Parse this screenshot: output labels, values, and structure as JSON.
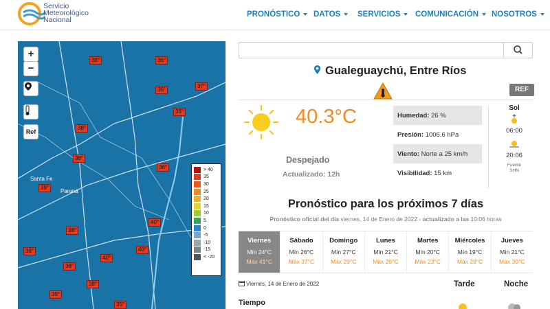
{
  "brand": {
    "line1": "Servicio",
    "line2": "Meteorológico",
    "line3": "Nacional"
  },
  "nav": [
    {
      "label": "PRONÓSTICO"
    },
    {
      "label": "DATOS"
    },
    {
      "label": "SERVICIOS"
    },
    {
      "label": "COMUNICACIÓN"
    },
    {
      "label": "NOSOTROS"
    }
  ],
  "map": {
    "zoom_in": "+",
    "zoom_out": "−",
    "ref_label": "Ref",
    "cities": [
      "Santa Fe",
      "Paraná"
    ],
    "temps": [
      {
        "v": "38°"
      },
      {
        "v": "36°"
      },
      {
        "v": "36°"
      },
      {
        "v": "37°"
      },
      {
        "v": "36°"
      },
      {
        "v": "38°"
      },
      {
        "v": "38°"
      },
      {
        "v": "36°"
      },
      {
        "v": "39°"
      },
      {
        "v": "40°"
      },
      {
        "v": "38°"
      },
      {
        "v": "36°"
      },
      {
        "v": "40°"
      },
      {
        "v": "40°"
      },
      {
        "v": "38°"
      },
      {
        "v": "39°"
      },
      {
        "v": "38°"
      },
      {
        "v": "35°"
      }
    ],
    "legend": [
      "> 40",
      "35",
      "30",
      "25",
      "20",
      "15",
      "10",
      "5",
      "0",
      "-5",
      "-10",
      "-15",
      "< -20"
    ],
    "legend_colors": [
      "#c40a0a",
      "#e53a1e",
      "#ef5a1a",
      "#f0891c",
      "#f2b021",
      "#e9d330",
      "#9bcf3a",
      "#3aa65a",
      "#2a86d0",
      "#7ea6c6",
      "#9aa7b0",
      "#7b858c",
      "#4f575c"
    ]
  },
  "search": {
    "placeholder": ""
  },
  "location": {
    "name": "Gualeguaychú, Entre Ríos"
  },
  "ref_button": "REF",
  "current": {
    "temperature": "40.3°C",
    "condition": "Despejado",
    "updated": "Actualizado: 12h"
  },
  "stats": [
    {
      "label": "Humedad:",
      "value": "26 %"
    },
    {
      "label": "Presión:",
      "value": "1006.6 hPa"
    },
    {
      "label": "Viento:",
      "value": "Norte a 25 km/h"
    },
    {
      "label": "Visibilidad:",
      "value": "15 km"
    }
  ],
  "sun": {
    "title": "Sol",
    "sunrise": "06:00",
    "sunset": "20:06",
    "source1": "Fuente",
    "source2": "SHN"
  },
  "forecast": {
    "title": "Pronóstico para los próximos 7 días",
    "sub_a": "Pronóstico oficial del día",
    "sub_b": "viernes, 14 de Enero de 2022",
    "sub_c": "- actualizado a las",
    "sub_d": "10:06 horas",
    "days": [
      {
        "name": "Viernes",
        "min": "Mín 24°C",
        "max": "Máx 41°C"
      },
      {
        "name": "Sábado",
        "min": "Mín 26°C",
        "max": "Máx 37°C"
      },
      {
        "name": "Domingo",
        "min": "Mín 27°C",
        "max": "Máx 29°C"
      },
      {
        "name": "Lunes",
        "min": "Mín 21°C",
        "max": "Máx 26°C"
      },
      {
        "name": "Martes",
        "min": "Mín 20°C",
        "max": "Máx 23°C"
      },
      {
        "name": "Miércoles",
        "min": "Mín 19°C",
        "max": "Máx 29°C"
      },
      {
        "name": "Jueves",
        "min": "Mín 21°C",
        "max": "Máx 30°C"
      }
    ],
    "date": "Viernes, 14 de Enero de 2022",
    "tarde": "Tarde",
    "noche": "Noche",
    "tiempo": "Tiempo"
  },
  "colors": {
    "accent": "#1e80c1",
    "temp": "#f28a1c",
    "map_bg": "#1a73a6"
  }
}
